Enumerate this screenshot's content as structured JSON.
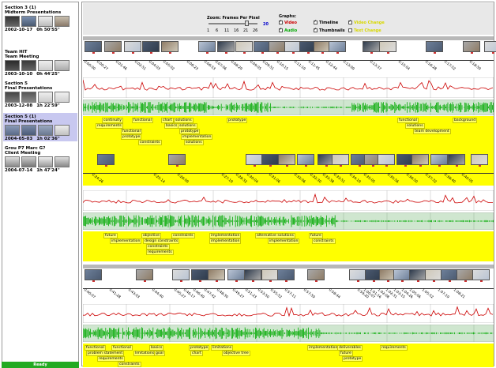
{
  "sessions": [
    {
      "title1": "Section 3 (1)",
      "title2": "Midterm Presentations",
      "date": "2002-10-17",
      "duration": "0h 50'55\"",
      "selected": false
    },
    {
      "title1": "Team HIT",
      "title2": "Team Meeting",
      "date": "2003-10-10",
      "duration": "0h 44'25\"",
      "selected": false
    },
    {
      "title1": "Section 5",
      "title2": "Final Presentations",
      "date": "2003-12-08",
      "duration": "1h 22'59\"",
      "selected": false
    },
    {
      "title1": "Section 5 (1)",
      "title2": "Final Presentations",
      "date": "2004-05-03",
      "duration": "1h 02'36\"",
      "selected": true
    },
    {
      "title1": "Grou P7 Marc G?",
      "title2": "Client Meeting",
      "date": "2004-07-14",
      "duration": "1h 47'24\"",
      "selected": false
    }
  ],
  "status": "Ready",
  "controls": {
    "zoom_title": "Zoom: Frames Per Pixel",
    "zoom_ticks": [
      "1",
      "6",
      "11",
      "16",
      "21",
      "26"
    ],
    "zoom_value": "20",
    "zoom_level": 0.78,
    "graphs_title": "Graphs:",
    "checkboxes": [
      {
        "label": "Video",
        "checked": true,
        "color": "#cc0000"
      },
      {
        "label": "Timeline",
        "checked": true,
        "color": "#000000"
      },
      {
        "label": "Video Change",
        "checked": true,
        "color": "#e8e800"
      },
      {
        "label": "Audio",
        "checked": true,
        "color": "#00aa00"
      },
      {
        "label": "Thumbnails",
        "checked": true,
        "color": "#000000"
      },
      {
        "label": "Text Change",
        "checked": false,
        "color": "#e8e800"
      }
    ]
  },
  "colors": {
    "video_graph": "#cc0000",
    "audio_graph": "#00aa00",
    "topic_bg": "#ffff00",
    "selected_session": "#c8c8f0",
    "status_bar": "#22aa22"
  },
  "bands": [
    {
      "time_labels": [
        "0:00:00",
        "0:00:27",
        "0:01:46",
        "0:02:51",
        "0:04:03",
        "0:05:02",
        "0:06:23",
        "0:06:53",
        "0:07:06",
        "0:08:29",
        "0:09:05",
        "0:09:51",
        "0:10:15",
        "0:11:19",
        "0:11:45",
        "0:12:44",
        "0:13:09",
        "0:13:37",
        "0:15:04",
        "0:16:28",
        "0:17:52",
        "0:18:59"
      ],
      "topics": [
        {
          "text": "continuity"
        },
        {
          "text": "functional"
        },
        {
          "text": "chart"
        },
        {
          "text": "solutions"
        },
        {
          "text": "prototype"
        },
        {
          "text": "requirements"
        },
        {
          "text": "basics"
        },
        {
          "text": "solutions"
        },
        {
          "text": "functional"
        },
        {
          "text": "prototype"
        },
        {
          "text": "prototype"
        },
        {
          "text": "implementation"
        },
        {
          "text": "constraints"
        },
        {
          "text": "solutions"
        },
        {
          "text": "functional"
        },
        {
          "text": "background"
        },
        {
          "text": "solutions"
        },
        {
          "text": "team development"
        }
      ]
    },
    {
      "time_labels": [
        "0:24:26",
        "0:25:14",
        "0:26:09",
        "0:27:19",
        "0:28:32",
        "0:30:04",
        "0:31:06",
        "0:32:06",
        "0:32:30",
        "0:33:38",
        "0:33:51",
        "0:34:19",
        "0:35:05",
        "0:35:56",
        "0:36:50",
        "0:37:32",
        "0:38:40",
        "0:40:05"
      ],
      "topics": [
        {
          "text": "future"
        },
        {
          "text": "objective"
        },
        {
          "text": "constraints"
        },
        {
          "text": "implementation"
        },
        {
          "text": "alternative solutions"
        },
        {
          "text": "future"
        },
        {
          "text": "implementation"
        },
        {
          "text": "design constraints"
        },
        {
          "text": "implementation"
        },
        {
          "text": "implementation"
        },
        {
          "text": "constraints"
        },
        {
          "text": "constraints"
        },
        {
          "text": "requirements"
        }
      ]
    },
    {
      "time_labels": [
        "0:40:07",
        "0:41:28",
        "0:43:03",
        "0:44:40",
        "0:45:27",
        "0:46:17",
        "0:46:49",
        "0:47:42",
        "0:48:30",
        "0:49:27",
        "0:51:23",
        "0:53:50",
        "0:55:52",
        "0:57:11",
        "0:57:59",
        "0:58:44",
        "0:59:20",
        "1:00:07",
        "1:01:16",
        "1:02:08",
        "1:02:31",
        "1:03:15",
        "1:04:26",
        "1:05:06",
        "1:05:52",
        "1:07:19",
        "1:08:21"
      ],
      "topics": [
        {
          "text": "functional"
        },
        {
          "text": "functional"
        },
        {
          "text": "basics"
        },
        {
          "text": "prototype"
        },
        {
          "text": "limitations"
        },
        {
          "text": "implementation"
        },
        {
          "text": "deliverables"
        },
        {
          "text": "requirements"
        },
        {
          "text": "problem statement"
        },
        {
          "text": "limitations"
        },
        {
          "text": "goal"
        },
        {
          "text": "chart"
        },
        {
          "text": "objective tree"
        },
        {
          "text": "future"
        },
        {
          "text": "requirements"
        },
        {
          "text": "prototype"
        },
        {
          "text": "constraints"
        }
      ]
    }
  ]
}
